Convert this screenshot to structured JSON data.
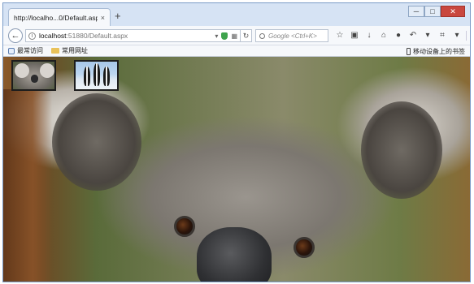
{
  "browser": {
    "tab": {
      "title": "http://localho...0/Default.aspx",
      "close": "×"
    },
    "new_tab": "+",
    "window_buttons": {
      "minimize": "─",
      "maximize": "□",
      "close": "✕"
    },
    "address": {
      "host": "localhost",
      "path": ":51880/Default.aspx"
    },
    "search": {
      "placeholder": "Google <Ctrl+K>"
    },
    "bookmarks": {
      "items": [
        {
          "label": "最常访问",
          "icon": "gear-icon"
        },
        {
          "label": "常用网址",
          "icon": "folder-icon"
        }
      ],
      "mobile": "移动设备上的书签"
    },
    "toolbar_icons": [
      "star-icon",
      "clipboard-icon",
      "download-icon",
      "home-icon",
      "chat-icon",
      "undo-icon",
      "crop-icon",
      "menu-icon"
    ]
  },
  "page": {
    "thumbnails": [
      {
        "name": "koala-thumbnail"
      },
      {
        "name": "penguins-thumbnail"
      }
    ],
    "background_image": "koala"
  },
  "colors": {
    "window_border": "#7b9cc7",
    "close_button": "#c9473e",
    "shield": "#3fa34d"
  }
}
